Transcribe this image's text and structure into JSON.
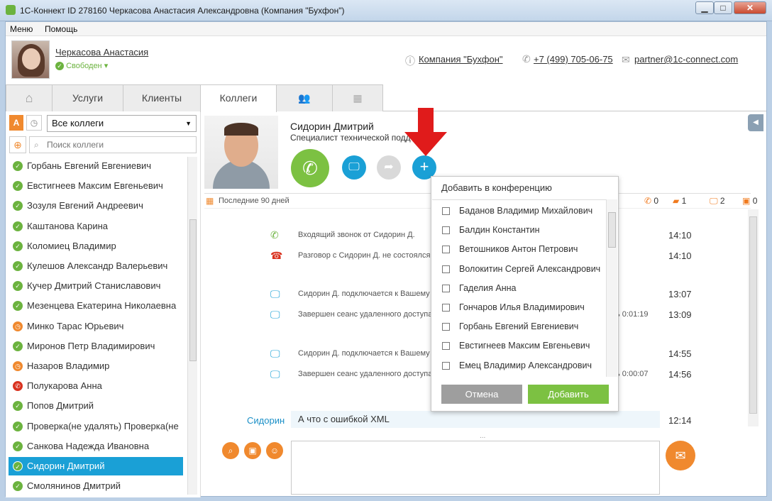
{
  "window": {
    "title": "1С-Коннект ID 278160 Черкасова Анастасия Александровна (Компания \"Бухфон\")",
    "minimize": "▁",
    "maximize": "□",
    "close": "✕"
  },
  "menu": {
    "items": [
      "Меню",
      "Помощь"
    ]
  },
  "user": {
    "name": "Черкасова Анастасия",
    "status": "Свободен ▾",
    "status_color": "#6cb33f"
  },
  "header": {
    "company": "Компания \"Бухфон\"",
    "phone": "+7 (499) 705-06-75",
    "email": "partner@1c-connect.com",
    "icons": [
      "info-icon",
      "phone-icon",
      "mail-icon"
    ]
  },
  "tabs": [
    {
      "label": "⌂",
      "icon": "home-icon"
    },
    {
      "label": "Услуги"
    },
    {
      "label": "Клиенты"
    },
    {
      "label": "Коллеги"
    },
    {
      "label": "👥",
      "icon": "group-icon"
    },
    {
      "label": "▦",
      "icon": "grid-icon"
    }
  ],
  "sidebar": {
    "filter_letter": "А",
    "select_value": "Все коллеги",
    "search_placeholder": "Поиск коллеги",
    "contacts": [
      {
        "name": "Горбань Евгений Евгениевич",
        "status": "online"
      },
      {
        "name": "Евстигнеев Максим Евгеньевич",
        "status": "online"
      },
      {
        "name": "Зозуля Евгений Андреевич",
        "status": "online"
      },
      {
        "name": "Каштанова Карина",
        "status": "online"
      },
      {
        "name": "Коломиец Владимир",
        "status": "online"
      },
      {
        "name": "Кулешов Александр Валерьевич",
        "status": "online"
      },
      {
        "name": "Кучер Дмитрий Станиславович",
        "status": "online"
      },
      {
        "name": "Мезенцева Екатерина Николаевна",
        "status": "online"
      },
      {
        "name": "Минко Тарас Юрьевич",
        "status": "away"
      },
      {
        "name": "Миронов Петр Владимирович",
        "status": "online"
      },
      {
        "name": "Назаров Владимир",
        "status": "away"
      },
      {
        "name": "Полукарова Анна",
        "status": "busy"
      },
      {
        "name": "Попов Дмитрий",
        "status": "online"
      },
      {
        "name": "Проверка(не удалять) Проверка(не",
        "status": "online"
      },
      {
        "name": "Санкова Надежда Ивановна",
        "status": "online"
      },
      {
        "name": "Сидорин Дмитрий",
        "status": "online",
        "selected": true
      },
      {
        "name": "Смолянинов Дмитрий",
        "status": "online"
      }
    ],
    "status_colors": {
      "online": "#6cb33f",
      "away": "#f0892e",
      "busy": "#d9321f"
    }
  },
  "contact": {
    "name": "Сидорин Дмитрий",
    "title": "Специалист технической подде..."
  },
  "actions": {
    "call": "✆",
    "screen": "🖵",
    "transfer": "➦",
    "add": "+"
  },
  "period": {
    "label": "Последние 90 дней",
    "counters": [
      {
        "icon": "phone-icon",
        "value": "0"
      },
      {
        "icon": "chat-icon",
        "value": "1"
      },
      {
        "icon": "screen-icon",
        "value": "2"
      },
      {
        "icon": "file-icon",
        "value": "0"
      }
    ]
  },
  "history": [
    {
      "icon": "incoming-call-icon",
      "glyph": "✆",
      "color": "#6cb33f",
      "text": "Входящий звонок от Сидорин Д.",
      "time": "14:10",
      "duration": ""
    },
    {
      "icon": "missed-call-icon",
      "glyph": "☎",
      "color": "#d9321f",
      "text": "Разговор с Сидорин Д. не состоялся.",
      "time": "14:10",
      "duration": ""
    },
    {
      "icon": "remote-access-icon",
      "glyph": "🖵",
      "color": "#1aa0d6",
      "text": "Сидорин Д. подключается к Вашему",
      "time": "13:07",
      "duration": ""
    },
    {
      "icon": "remote-access-icon",
      "glyph": "🖵",
      "color": "#1aa0d6",
      "text": "Завершен сеанс удаленного доступа",
      "time": "13:09",
      "duration": "ь 0:01:19"
    },
    {
      "icon": "remote-access-icon",
      "glyph": "🖵",
      "color": "#1aa0d6",
      "text": "Сидорин Д. подключается к Вашему",
      "time": "14:55",
      "duration": ""
    },
    {
      "icon": "remote-access-icon",
      "glyph": "🖵",
      "color": "#1aa0d6",
      "text": "Завершен сеанс удаленного доступа",
      "time": "14:56",
      "duration": "ь 0:00:07"
    }
  ],
  "chat": {
    "sender": "Сидорин",
    "message": "А что с ошибкой XML",
    "time": "12:14",
    "splitter": "..."
  },
  "toolbar": [
    "search-icon",
    "archive-icon",
    "smiley-icon"
  ],
  "conference": {
    "title": "Добавить в конференцию",
    "members": [
      "Баданов Владимир Михайлович",
      "Балдин Константин",
      "Ветошников Антон Петрович",
      "Волокитин Сергей Александрович",
      "Гаделия Анна",
      "Гончаров Илья Владимирович",
      "Горбань Евгений Евгениевич",
      "Евстигнеев Максим Евгеньевич",
      "Емец Владимир Александрович"
    ],
    "cancel_label": "Отмена",
    "add_label": "Добавить"
  }
}
